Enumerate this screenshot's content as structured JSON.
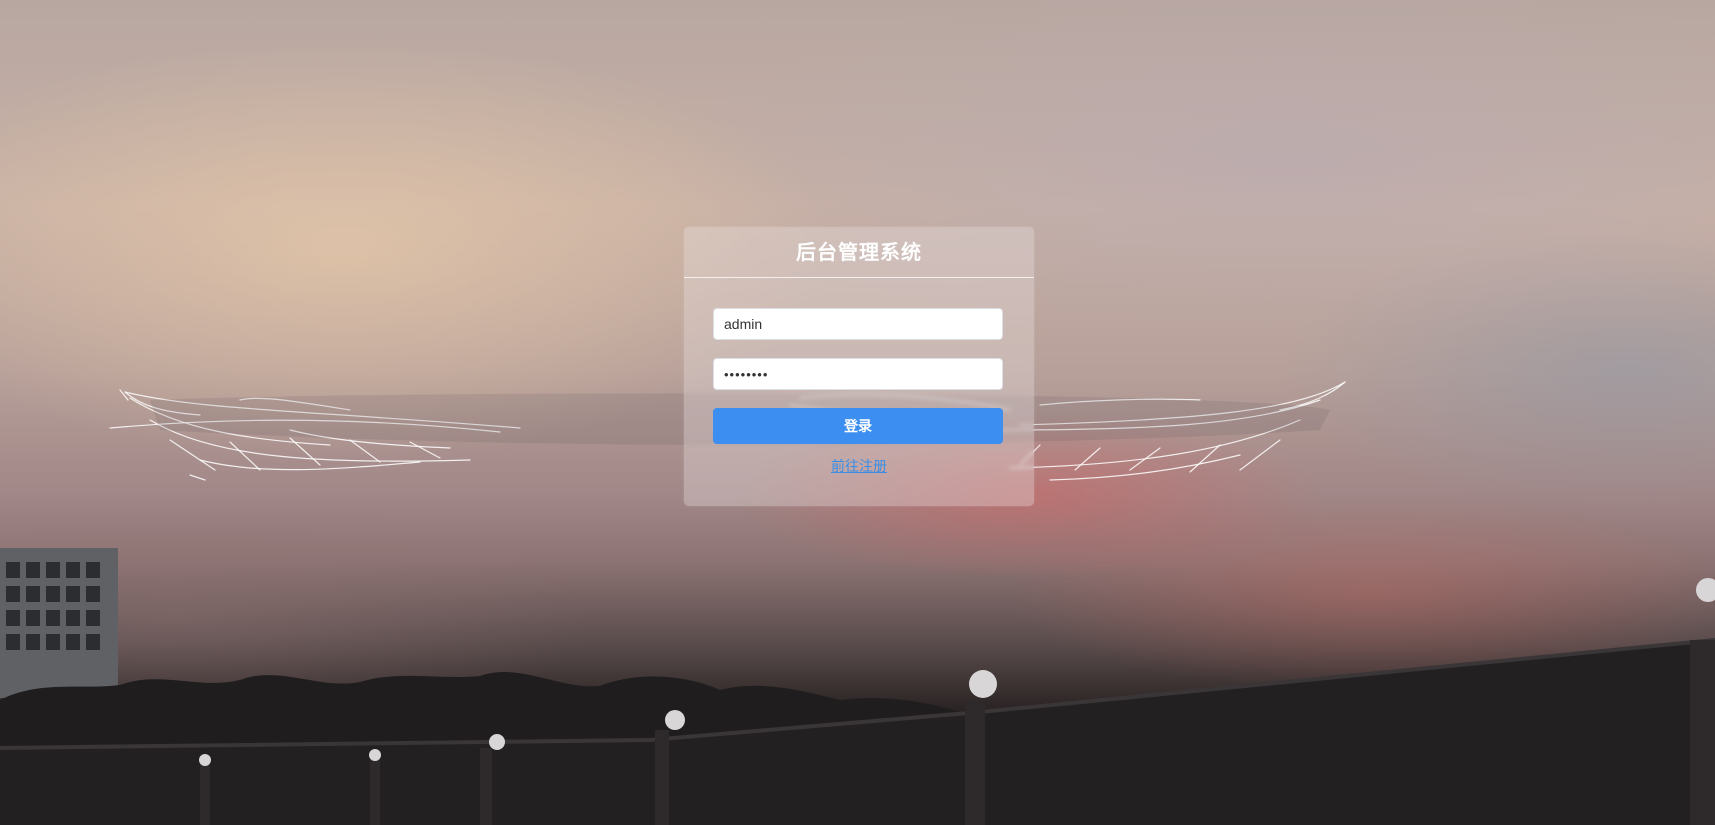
{
  "login": {
    "title": "后台管理系统",
    "username_value": "admin",
    "password_value": "••••••••",
    "login_button": "登录",
    "register_link": "前往注册"
  },
  "colors": {
    "primary": "#3c8ff0",
    "link": "#3a8ee6",
    "panel": "rgba(235,225,225,0.35)"
  },
  "background": {
    "description_icon": "sunset-sky-with-angel-wings-photo"
  }
}
